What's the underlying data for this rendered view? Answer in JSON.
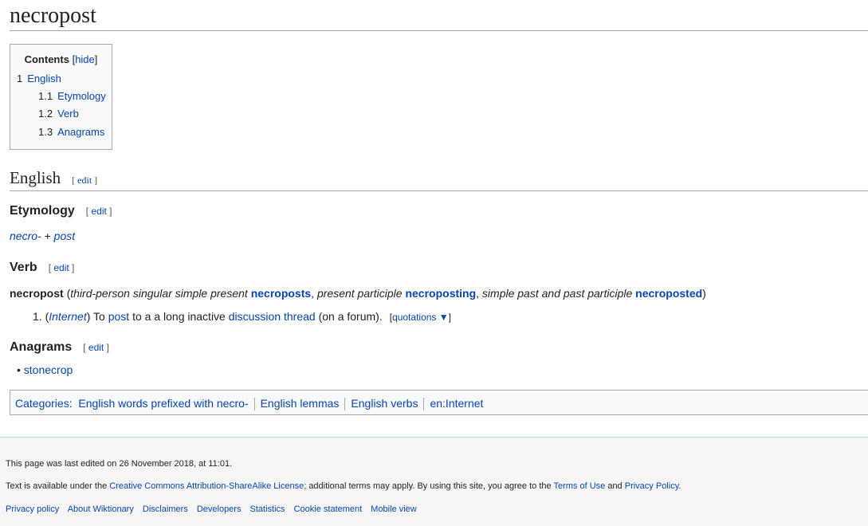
{
  "title": "necropost",
  "toc": {
    "title": "Contents",
    "hide": "hide",
    "items": [
      {
        "num": "1",
        "label": "English"
      },
      {
        "num": "1.1",
        "label": "Etymology"
      },
      {
        "num": "1.2",
        "label": "Verb"
      },
      {
        "num": "1.3",
        "label": "Anagrams"
      }
    ]
  },
  "edit_label": "edit",
  "english": {
    "heading": "English"
  },
  "etymology": {
    "heading": "Etymology",
    "prefix": "necro-",
    "plus": " + ",
    "word": "post"
  },
  "verb": {
    "heading": "Verb",
    "headword": "necropost",
    "open": " (",
    "l1": "third-person singular simple present",
    "f1": "necroposts",
    "l2": "present participle",
    "f2": "necroposting",
    "l3": "simple past and past participle",
    "f3": "necroposted",
    "close": ")",
    "def": {
      "num": "1.",
      "label": "Internet",
      "t1": "To ",
      "link1": "post",
      "t2": " to a a long inactive ",
      "link2": "discussion thread",
      "t3": " (on a forum).",
      "quotations": "quotations ▼"
    }
  },
  "anagrams": {
    "heading": "Anagrams",
    "items": [
      "stonecrop"
    ]
  },
  "categories": {
    "label": "Categories",
    "items": [
      "English words prefixed with necro-",
      "English lemmas",
      "English verbs",
      "en:Internet"
    ]
  },
  "footer": {
    "last_edited": "This page was last edited on 26 November 2018, at 11:01.",
    "license_pre": "Text is available under the ",
    "license_link": "Creative Commons Attribution-ShareAlike License",
    "license_mid": "; additional terms may apply. By using this site, you agree to the ",
    "terms": "Terms of Use",
    "and": " and ",
    "privacy": "Privacy Policy",
    "end": ".",
    "links": [
      "Privacy policy",
      "About Wiktionary",
      "Disclaimers",
      "Developers",
      "Statistics",
      "Cookie statement",
      "Mobile view"
    ]
  }
}
